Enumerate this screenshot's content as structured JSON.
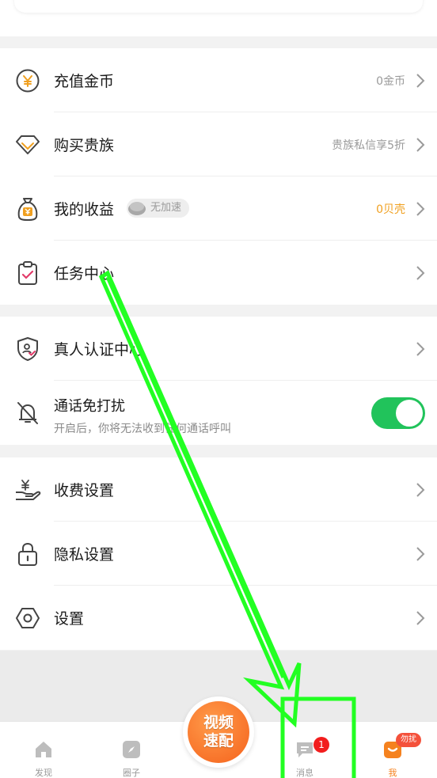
{
  "menu_group1": [
    {
      "label": "充值金币",
      "right": "0金币",
      "icon": "coin-icon"
    },
    {
      "label": "购买贵族",
      "right": "贵族私信享5折",
      "icon": "diamond-icon"
    },
    {
      "label": "我的收益",
      "badge": "无加速",
      "right": "0贝壳",
      "icon": "money-bag-icon"
    },
    {
      "label": "任务中心",
      "right": "",
      "icon": "clipboard-check-icon"
    }
  ],
  "menu_group2": [
    {
      "label": "真人认证中心",
      "icon": "shield-check-icon"
    },
    {
      "label": "通话免打扰",
      "sub": "开启后，你将无法收到任何通话呼叫",
      "icon": "bell-off-icon",
      "toggle": true
    }
  ],
  "menu_group3": [
    {
      "label": "收费设置",
      "icon": "hand-coin-icon"
    },
    {
      "label": "隐私设置",
      "icon": "lock-icon"
    },
    {
      "label": "设置",
      "icon": "hexagon-settings-icon"
    }
  ],
  "tabbar": {
    "discover": "发现",
    "circle": "圈子",
    "fab_line1": "视频",
    "fab_line2": "速配",
    "messages": "消息",
    "messages_badge": "1",
    "me": "我",
    "me_badge": "勿扰"
  },
  "colors": {
    "accent_orange": "#f5621c",
    "toggle_green": "#21c35b",
    "shell_yellow": "#f0a020",
    "overlay_green": "#22ff22"
  }
}
